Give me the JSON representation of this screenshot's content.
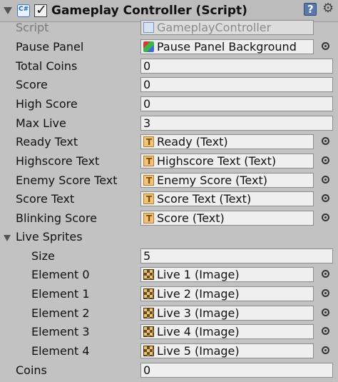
{
  "header": {
    "title": "Gameplay Controller (Script)"
  },
  "script": {
    "label": "Script",
    "value": "GameplayController"
  },
  "pause_panel": {
    "label": "Pause Panel",
    "value": "Pause Panel Background"
  },
  "total_coins": {
    "label": "Total Coins",
    "value": "0"
  },
  "score": {
    "label": "Score",
    "value": "0"
  },
  "high_score": {
    "label": "High Score",
    "value": "0"
  },
  "max_live": {
    "label": "Max Live",
    "value": "3"
  },
  "ready_text": {
    "label": "Ready Text",
    "value": "Ready (Text)"
  },
  "highscore_text": {
    "label": "Highscore Text",
    "value": "Highscore Text (Text)"
  },
  "enemy_score_text": {
    "label": "Enemy Score Text",
    "value": "Enemy Score (Text)"
  },
  "score_text": {
    "label": "Score Text",
    "value": "Score Text (Text)"
  },
  "blinking_score": {
    "label": "Blinking Score",
    "value": "Score (Text)"
  },
  "live_sprites": {
    "label": "Live Sprites",
    "size_label": "Size",
    "size_value": "5",
    "elements": [
      {
        "label": "Element 0",
        "value": "Live 1 (Image)"
      },
      {
        "label": "Element 1",
        "value": "Live 2 (Image)"
      },
      {
        "label": "Element 2",
        "value": "Live 3 (Image)"
      },
      {
        "label": "Element 3",
        "value": "Live 4 (Image)"
      },
      {
        "label": "Element 4",
        "value": "Live 5 (Image)"
      }
    ]
  },
  "coins": {
    "label": "Coins",
    "value": "0"
  }
}
